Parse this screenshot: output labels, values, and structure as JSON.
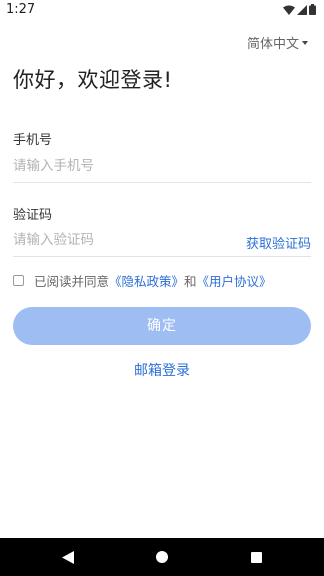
{
  "status_bar": {
    "time": "1:27",
    "icons": [
      "wifi-icon",
      "signal-icon",
      "battery-icon"
    ]
  },
  "language": {
    "selected": "简体中文"
  },
  "greeting": "你好，欢迎登录!",
  "phone": {
    "label": "手机号",
    "placeholder": "请输入手机号",
    "value": ""
  },
  "code": {
    "label": "验证码",
    "placeholder": "请输入验证码",
    "value": "",
    "get_code_label": "获取验证码"
  },
  "agreement": {
    "checked": false,
    "prefix": "已阅读并同意",
    "privacy_link": "《隐私政策》",
    "and": "和",
    "terms_link": "《用户协议》"
  },
  "confirm_label": "确定",
  "email_login_label": "邮箱登录",
  "colors": {
    "accent": "#2b6fd8",
    "button_disabled": "#9dbdf3",
    "nav_bar": "#000000"
  },
  "nav_bar": {
    "buttons": [
      "back-icon",
      "home-icon",
      "recents-icon"
    ]
  }
}
